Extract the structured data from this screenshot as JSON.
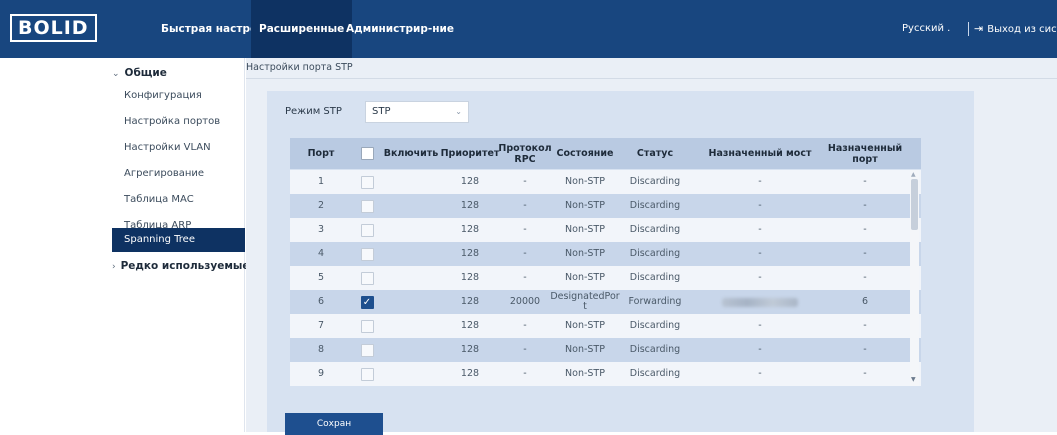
{
  "header": {
    "logo": "BOLID",
    "tabs": [
      {
        "label": "Быстрая настройка"
      },
      {
        "label": "Расширенные"
      },
      {
        "label": "Администрир-ние"
      }
    ],
    "language": "Русский .",
    "logout": "Выход из системы"
  },
  "sidebar": {
    "group_general": "Общие",
    "items": [
      {
        "label": "Конфигурация"
      },
      {
        "label": "Настройка портов"
      },
      {
        "label": "Настройки VLAN"
      },
      {
        "label": "Агрегирование"
      },
      {
        "label": "Таблица MAC"
      },
      {
        "label": "Таблица ARP"
      },
      {
        "label": "Spanning Tree"
      }
    ],
    "group_rare": "Редко используемые"
  },
  "content": {
    "tab": "Настройки порта STP",
    "mode_label": "Режим STP",
    "mode_value": "STP",
    "save_label": "Сохран"
  },
  "table": {
    "headers": {
      "port": "Порт",
      "enable": "Включить",
      "priority": "Приоритет",
      "rpc": "Протокол RPC",
      "state": "Состояние",
      "status": "Статус",
      "bridge": "Назначенный мост",
      "dport": "Назначенный порт"
    },
    "rows": [
      {
        "port": "1",
        "checked": false,
        "priority": "128",
        "rpc": "-",
        "state": "Non-STP",
        "status": "Discarding",
        "bridge": "-",
        "dport": "-"
      },
      {
        "port": "2",
        "checked": false,
        "priority": "128",
        "rpc": "-",
        "state": "Non-STP",
        "status": "Discarding",
        "bridge": "-",
        "dport": "-"
      },
      {
        "port": "3",
        "checked": false,
        "priority": "128",
        "rpc": "-",
        "state": "Non-STP",
        "status": "Discarding",
        "bridge": "-",
        "dport": "-"
      },
      {
        "port": "4",
        "checked": false,
        "priority": "128",
        "rpc": "-",
        "state": "Non-STP",
        "status": "Discarding",
        "bridge": "-",
        "dport": "-"
      },
      {
        "port": "5",
        "checked": false,
        "priority": "128",
        "rpc": "-",
        "state": "Non-STP",
        "status": "Discarding",
        "bridge": "-",
        "dport": "-"
      },
      {
        "port": "6",
        "checked": true,
        "priority": "128",
        "rpc": "20000",
        "state": "DesignatedPor t",
        "status": "Forwarding",
        "bridge": "",
        "dport": "6"
      },
      {
        "port": "7",
        "checked": false,
        "priority": "128",
        "rpc": "-",
        "state": "Non-STP",
        "status": "Discarding",
        "bridge": "-",
        "dport": "-"
      },
      {
        "port": "8",
        "checked": false,
        "priority": "128",
        "rpc": "-",
        "state": "Non-STP",
        "status": "Discarding",
        "bridge": "-",
        "dport": "-"
      },
      {
        "port": "9",
        "checked": false,
        "priority": "128",
        "rpc": "-",
        "state": "Non-STP",
        "status": "Discarding",
        "bridge": "-",
        "dport": "-"
      }
    ]
  },
  "colors": {
    "header_bg": "#18467f",
    "active_bg": "#0e3262",
    "panel_bg": "#d7e2f1",
    "accent": "#1e4f8f"
  }
}
